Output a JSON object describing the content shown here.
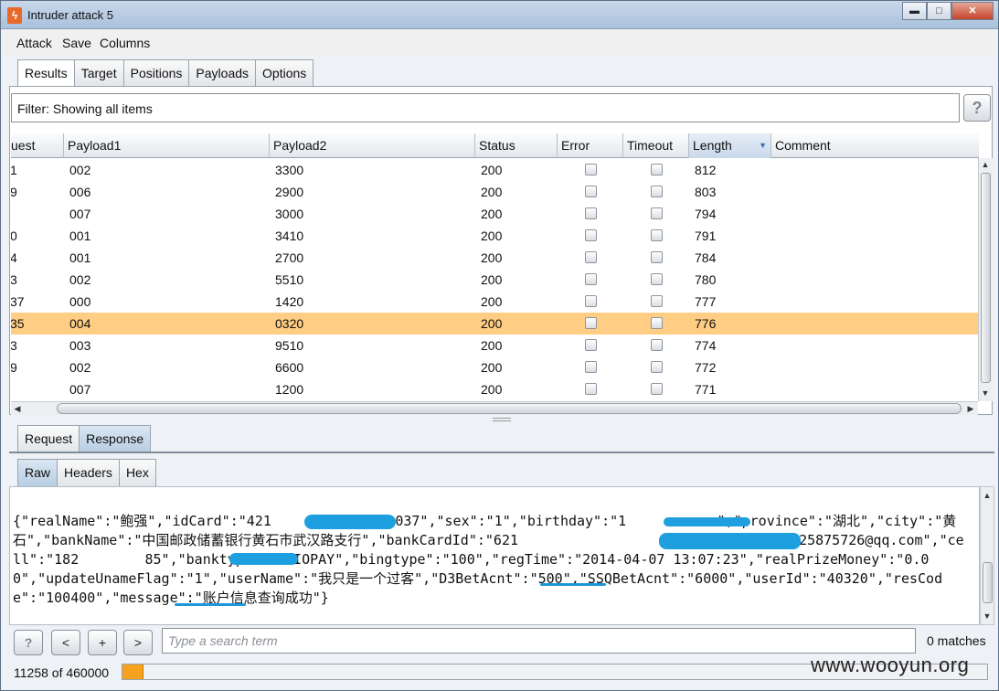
{
  "window": {
    "title": "Intruder attack 5",
    "minimize": "▬",
    "maximize": "□",
    "close": "✕"
  },
  "menu": [
    "Attack",
    "Save",
    "Columns"
  ],
  "tabs": [
    "Results",
    "Target",
    "Positions",
    "Payloads",
    "Options"
  ],
  "filter": {
    "text": "Filter: Showing all items",
    "help": "?"
  },
  "table": {
    "columns": [
      "uest",
      "Payload1",
      "Payload2",
      "Status",
      "Error",
      "Timeout",
      "Length",
      "Comment"
    ],
    "rows": [
      {
        "req": "1",
        "p1": "002",
        "p2": "3300",
        "status": "200",
        "length": "812"
      },
      {
        "req": "9",
        "p1": "006",
        "p2": "2900",
        "status": "200",
        "length": "803"
      },
      {
        "req": "",
        "p1": "007",
        "p2": "3000",
        "status": "200",
        "length": "794"
      },
      {
        "req": "0",
        "p1": "001",
        "p2": "3410",
        "status": "200",
        "length": "791"
      },
      {
        "req": "4",
        "p1": "001",
        "p2": "2700",
        "status": "200",
        "length": "784"
      },
      {
        "req": "3",
        "p1": "002",
        "p2": "5510",
        "status": "200",
        "length": "780"
      },
      {
        "req": "37",
        "p1": "000",
        "p2": "1420",
        "status": "200",
        "length": "777"
      },
      {
        "req": "35",
        "p1": "004",
        "p2": "0320",
        "status": "200",
        "length": "776",
        "selected": true
      },
      {
        "req": "3",
        "p1": "003",
        "p2": "9510",
        "status": "200",
        "length": "774"
      },
      {
        "req": "9",
        "p1": "002",
        "p2": "6600",
        "status": "200",
        "length": "772"
      },
      {
        "req": "",
        "p1": "007",
        "p2": "1200",
        "status": "200",
        "length": "771"
      }
    ]
  },
  "lower_tabs": [
    "Request",
    "Response"
  ],
  "view_tabs": [
    "Raw",
    "Headers",
    "Hex"
  ],
  "response_body": "{\"realName\":\"鲍强\",\"idCard\":\"421               037\",\"sex\":\"1\",\"birthday\":\"1           \",\"province\":\"湖北\",\"city\":\"黄石\",\"bankName\":\"中国邮政储蓄银行黄石市武汉路支行\",\"bankCardId\":\"621                   39\",\"email\":\"2225875726@qq.com\",\"cell\":\"182        85\",\"banktype\":\"UNIOPAY\",\"bingtype\":\"100\",\"regTime\":\"2014-04-07 13:07:23\",\"realPrizeMoney\":\"0.00\",\"updateUnameFlag\":\"1\",\"userName\":\"我只是一个过客\",\"D3BetAcnt\":\"500\",\"SSQBetAcnt\":\"6000\",\"userId\":\"40320\",\"resCode\":\"100400\",\"message\":\"账户信息查询成功\"}",
  "search": {
    "help": "?",
    "prev": "<",
    "add": "+",
    "next": ">",
    "placeholder": "Type a search term",
    "matches": "0 matches"
  },
  "status": {
    "progress_text": "11258 of 460000",
    "progress_fraction": 0.0245
  },
  "watermark": "www.wooyun.org",
  "colors": {
    "selected_row": "#ffcd83",
    "progress": "#f6a21e",
    "redaction": "#1ea0e0"
  }
}
